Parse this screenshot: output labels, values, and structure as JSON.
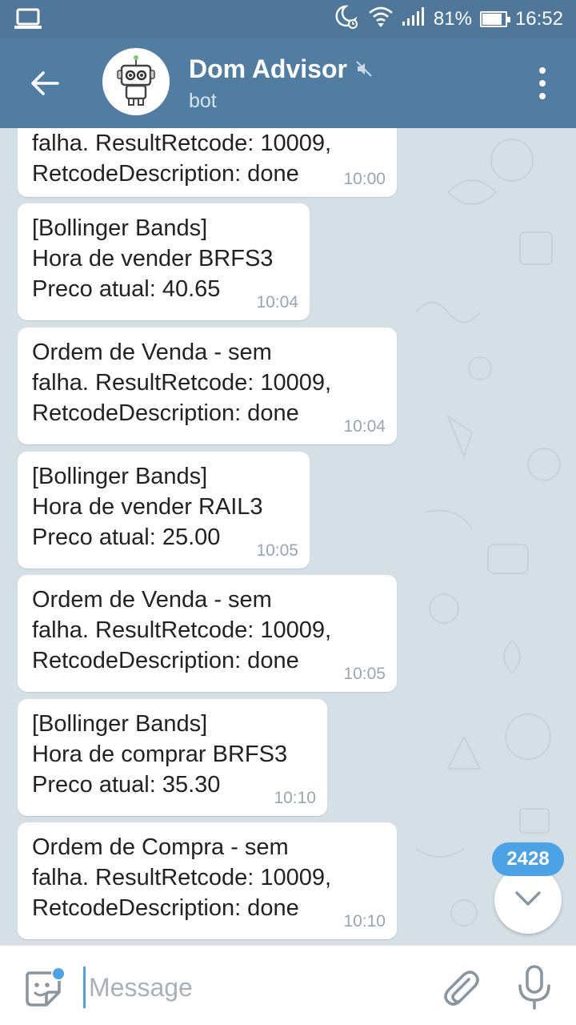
{
  "status_bar": {
    "battery": "81%",
    "battery_level": 0.81,
    "time": "16:52"
  },
  "header": {
    "title": "Dom Advisor",
    "subtitle": "bot",
    "muted": true
  },
  "messages": [
    {
      "text": "falha. ResultRetcode: 10009,\nRetcodeDescription: done",
      "time": "10:00"
    },
    {
      "text": "[Bollinger Bands]\nHora de vender BRFS3\nPreco atual: 40.65",
      "time": "10:04"
    },
    {
      "text": "Ordem de Venda - sem\nfalha. ResultRetcode: 10009,\nRetcodeDescription: done",
      "time": "10:04"
    },
    {
      "text": "[Bollinger Bands]\nHora de vender RAIL3\nPreco atual: 25.00",
      "time": "10:05"
    },
    {
      "text": "Ordem de Venda - sem\nfalha. ResultRetcode: 10009,\nRetcodeDescription: done",
      "time": "10:05"
    },
    {
      "text": "[Bollinger Bands]\nHora de comprar BRFS3\nPreco atual: 35.30",
      "time": "10:10"
    },
    {
      "text": "Ordem de Compra - sem\nfalha. ResultRetcode: 10009,\nRetcodeDescription: done",
      "time": "10:10"
    }
  ],
  "unread_count": "2428",
  "composer": {
    "placeholder": "Message"
  },
  "colors": {
    "header": "#527da3",
    "status_bar": "#4f779a",
    "chat_background": "#d5dfe6",
    "accent": "#4ba2e5",
    "time_text": "#9aa5ae"
  },
  "icons": [
    "laptop-icon",
    "do-not-disturb-alarm-icon",
    "wifi-icon",
    "signal-icon",
    "battery-icon",
    "back-arrow-icon",
    "bot-avatar",
    "muted-speaker-icon",
    "more-vert-icon",
    "chevron-down-icon",
    "sticker-icon",
    "paperclip-icon",
    "microphone-icon"
  ]
}
